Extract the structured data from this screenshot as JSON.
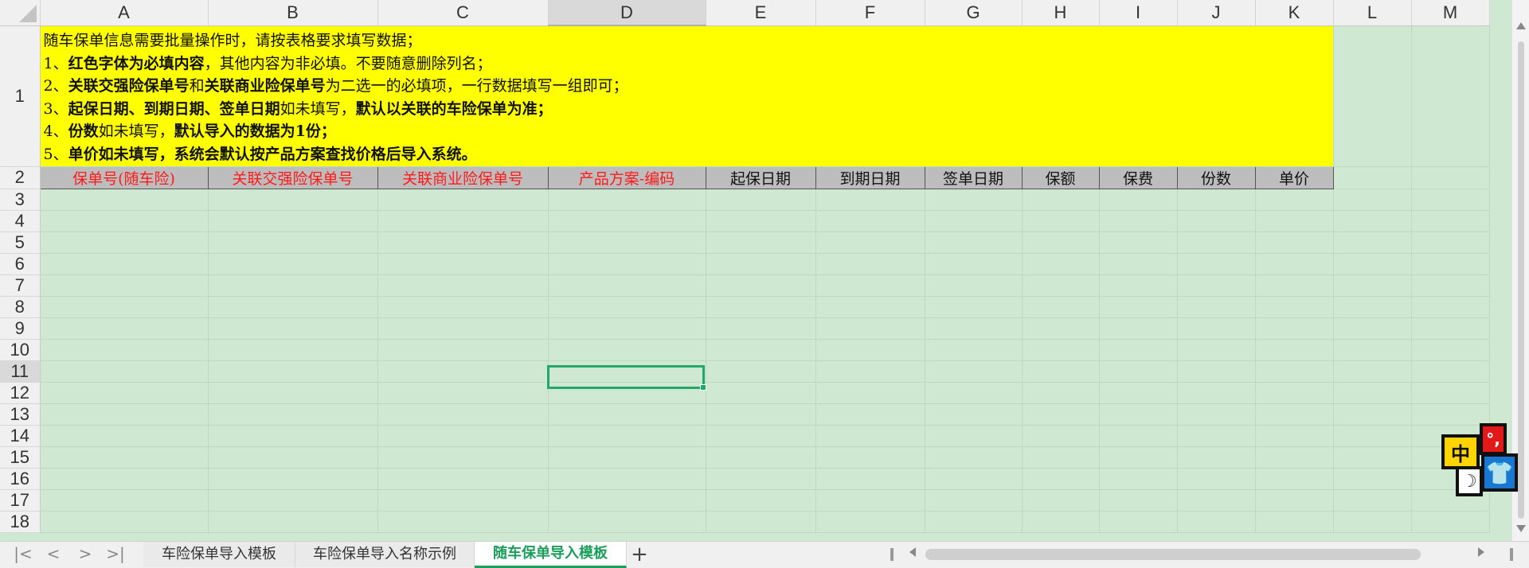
{
  "columns": [
    "A",
    "B",
    "C",
    "D",
    "E",
    "F",
    "G",
    "H",
    "I",
    "J",
    "K",
    "L",
    "M"
  ],
  "rows": [
    "1",
    "2",
    "3",
    "4",
    "5",
    "6",
    "7",
    "8",
    "9",
    "10",
    "11",
    "12",
    "13",
    "14",
    "15",
    "16",
    "17",
    "18"
  ],
  "selected_column": "D",
  "selected_row": "11",
  "instructions": {
    "line0": "随车保单信息需要批量操作时，请按表格要求填写数据；",
    "line1": [
      {
        "text": "1、",
        "bold": false
      },
      {
        "text": "红色字体为必填内容",
        "bold": true
      },
      {
        "text": "，其他内容为非必填。不要随意删除列名；",
        "bold": false
      }
    ],
    "line2": [
      {
        "text": "2、",
        "bold": false
      },
      {
        "text": "关联交强险保单号",
        "bold": true
      },
      {
        "text": "和",
        "bold": false
      },
      {
        "text": "关联商业险保单号",
        "bold": true
      },
      {
        "text": "为二选一的必填项，一行数据填写一组即可；",
        "bold": false
      }
    ],
    "line3": [
      {
        "text": "3、",
        "bold": false
      },
      {
        "text": "起保日期、到期日期、签单日期",
        "bold": true
      },
      {
        "text": "如未填写，",
        "bold": false
      },
      {
        "text": "默认以关联的车险保单为准；",
        "bold": true
      }
    ],
    "line4": [
      {
        "text": "4、",
        "bold": false
      },
      {
        "text": "份数",
        "bold": true
      },
      {
        "text": "如未填写，",
        "bold": false
      },
      {
        "text": "默认导入的数据为1份；",
        "bold": true
      }
    ],
    "line5": [
      {
        "text": "5、",
        "bold": false
      },
      {
        "text": "单价如未填写，系统会默认按产品方案查找价格后导入系统。",
        "bold": true
      }
    ]
  },
  "headers": [
    {
      "label": "保单号(随车险)",
      "required": true
    },
    {
      "label": "关联交强险保单号",
      "required": true
    },
    {
      "label": "关联商业险保单号",
      "required": true
    },
    {
      "label": "产品方案-编码",
      "required": true
    },
    {
      "label": "起保日期",
      "required": false
    },
    {
      "label": "到期日期",
      "required": false
    },
    {
      "label": "签单日期",
      "required": false
    },
    {
      "label": "保额",
      "required": false
    },
    {
      "label": "保费",
      "required": false
    },
    {
      "label": "份数",
      "required": false
    },
    {
      "label": "单价",
      "required": false
    }
  ],
  "ime": {
    "mode": "中",
    "punct": "°,",
    "moon": "☽",
    "shirt": "👕"
  },
  "tabs": [
    {
      "label": "车险保单导入模板",
      "active": false
    },
    {
      "label": "车险保单导入名称示例",
      "active": false
    },
    {
      "label": "随车保单导入模板",
      "active": true
    }
  ],
  "tab_nav": {
    "first": "|<",
    "prev": "<",
    "next": ">",
    "last": ">|",
    "add": "+"
  },
  "colors": {
    "cell_bg": "#cfe8d1",
    "note_bg": "#ffff00",
    "header_bg": "#bdbdbd",
    "required_text": "#ff1a1a",
    "selection": "#23a86a",
    "active_tab": "#1a9e5a"
  }
}
